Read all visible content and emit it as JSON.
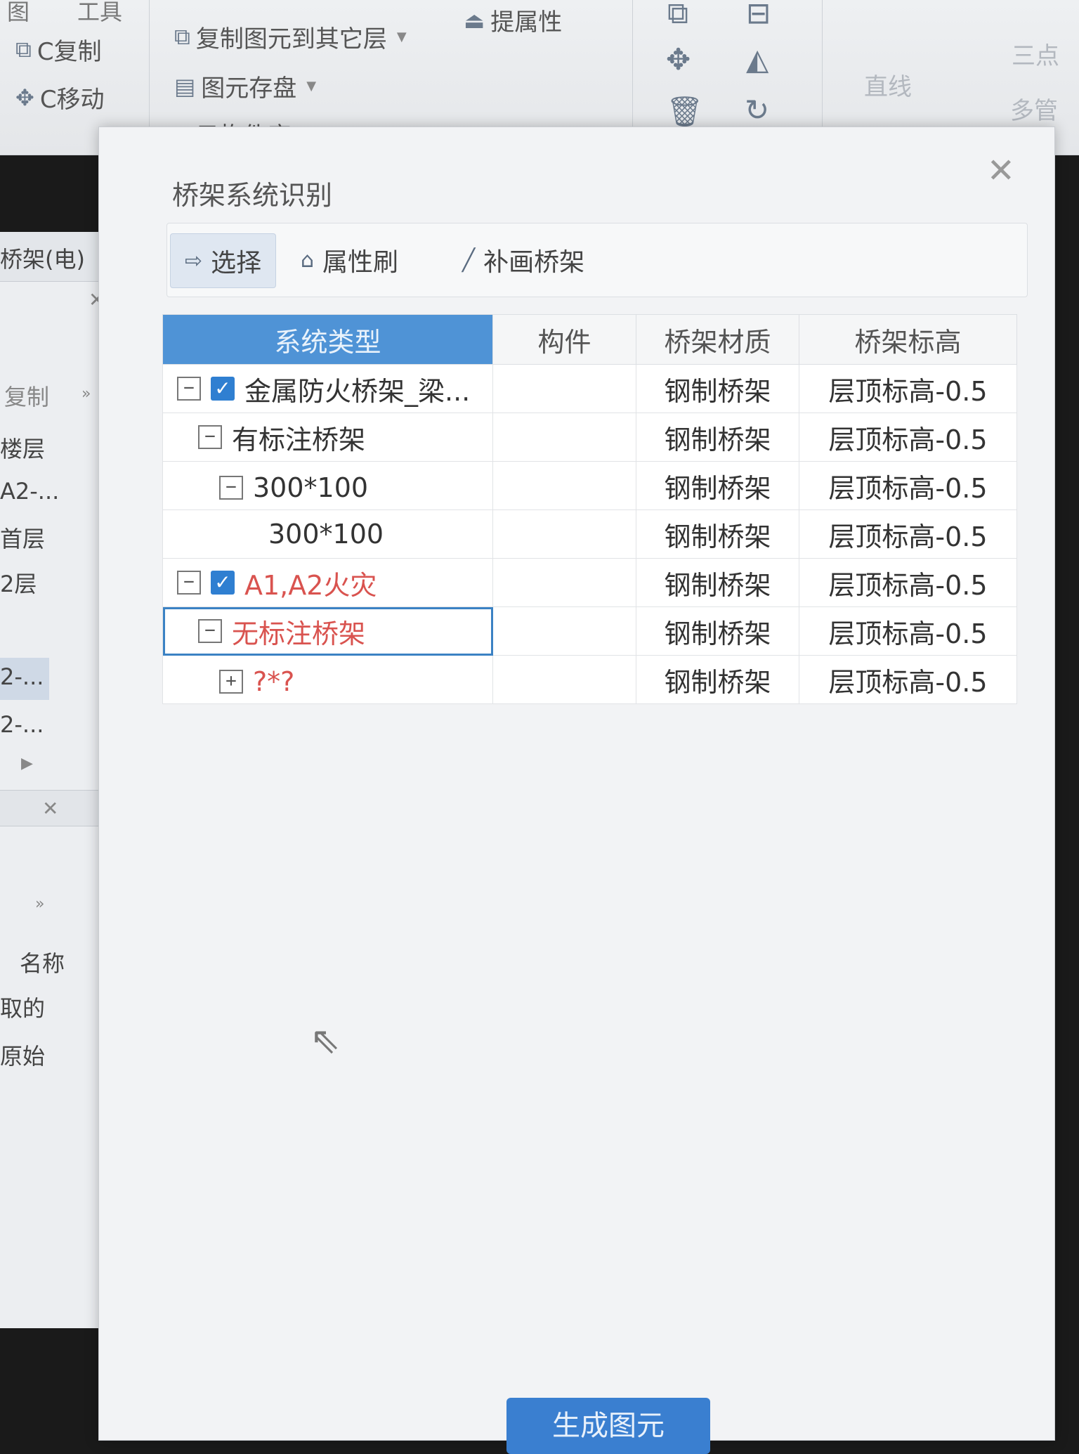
{
  "ribbon": {
    "tab_partial": "图",
    "tab_partial2": "工具",
    "copy_label": "C复制",
    "move_label": "C移动",
    "copy_to_layer_label": "复制图元到其它层",
    "save_element_label": "图元存盘",
    "cloud_library_label": "云构件库",
    "extract_attr_label": "提属性",
    "line_label": "直线",
    "multi_pipe_label": "多管",
    "three_label": "三点"
  },
  "left_panel": {
    "header": "桥架(电)",
    "copy_label": "复制",
    "items": [
      "楼层",
      "A2-...",
      "首层",
      "2层",
      "2-...",
      "2-..."
    ],
    "bottom_items": [
      "名称",
      "取的",
      "原始"
    ]
  },
  "dialog": {
    "title": "桥架系统识别",
    "toolbar": {
      "select_label": "选择",
      "brush_label": "属性刷",
      "draw_label": "补画桥架"
    },
    "columns": [
      "系统类型",
      "构件",
      "桥架材质",
      "桥架标高"
    ],
    "rows": [
      {
        "name": "金属防火桥架_梁...",
        "component": "",
        "material": "钢制桥架",
        "elevation": "层顶标高-0.5"
      },
      {
        "name": "有标注桥架",
        "component": "",
        "material": "钢制桥架",
        "elevation": "层顶标高-0.5"
      },
      {
        "name": "300*100",
        "component": "",
        "material": "钢制桥架",
        "elevation": "层顶标高-0.5"
      },
      {
        "name": "300*100",
        "component": "",
        "material": "钢制桥架",
        "elevation": "层顶标高-0.5"
      },
      {
        "name": "A1,A2火灾",
        "component": "",
        "material": "钢制桥架",
        "elevation": "层顶标高-0.5"
      },
      {
        "name": "无标注桥架",
        "component": "",
        "material": "钢制桥架",
        "elevation": "层顶标高-0.5"
      },
      {
        "name": "?*?",
        "component": "",
        "material": "钢制桥架",
        "elevation": "层顶标高-0.5"
      }
    ],
    "bottom_button": "生成图元"
  },
  "colors": {
    "accent": "#4f93d6",
    "checkbox": "#2f7fd1",
    "unmarked_text": "#d9534f"
  }
}
